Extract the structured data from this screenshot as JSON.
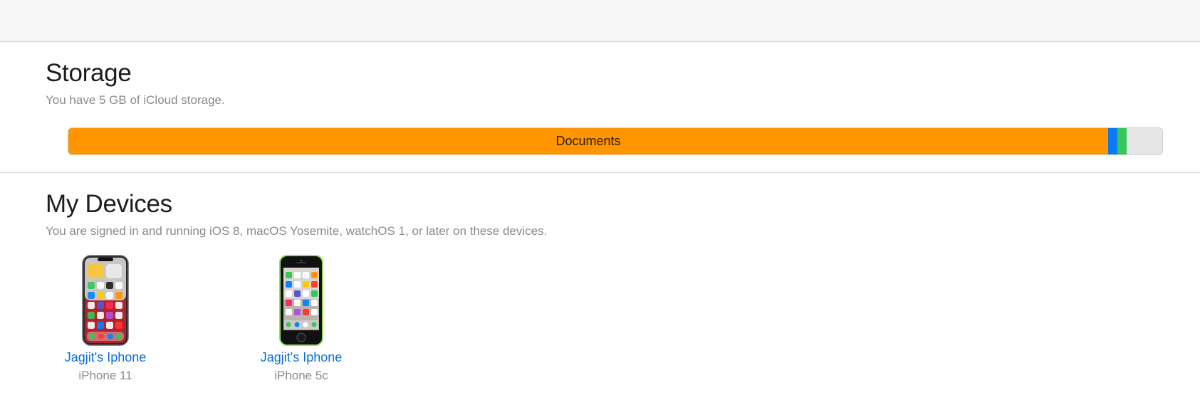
{
  "storage": {
    "title": "Storage",
    "subtitle": "You have 5 GB of iCloud storage.",
    "segments": [
      {
        "label": "Documents",
        "fraction": 0.9505,
        "color": "#ff9500"
      },
      {
        "label": "",
        "fraction": 0.0085,
        "color": "#0a7af5"
      },
      {
        "label": "",
        "fraction": 0.0085,
        "color": "#34c759"
      }
    ],
    "free_color": "#e6e6e6"
  },
  "devices": {
    "title": "My Devices",
    "subtitle": "You are signed in and running iOS 8, macOS Yosemite, watchOS 1, or later on these devices.",
    "items": [
      {
        "name": "Jagjit's Iphone",
        "model": "iPhone 11",
        "icon": "iphone-11-icon"
      },
      {
        "name": "Jagjit's Iphone",
        "model": "iPhone 5c",
        "icon": "iphone-5c-icon"
      }
    ]
  }
}
